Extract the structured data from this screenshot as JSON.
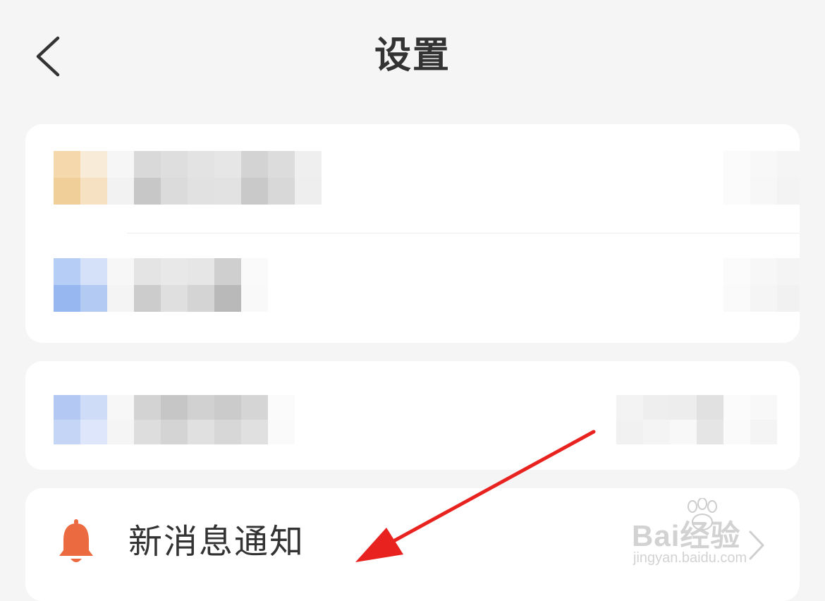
{
  "header": {
    "title": "设置",
    "back_icon": "chevron-left-icon"
  },
  "cards": [
    {
      "rows": 2,
      "content": "blurred"
    },
    {
      "rows": 1,
      "content": "blurred"
    }
  ],
  "notifications_row": {
    "label": "新消息通知",
    "icon": "bell-icon",
    "icon_color": "#ec6a3f",
    "trailing_icon": "chevron-right-icon"
  },
  "annotation": {
    "color": "#e8231f"
  },
  "watermark": {
    "brand": "Bai经验",
    "url": "jingyan.baidu.com"
  },
  "colors": {
    "background": "#f5f5f5",
    "card": "#ffffff",
    "text": "#333333"
  }
}
